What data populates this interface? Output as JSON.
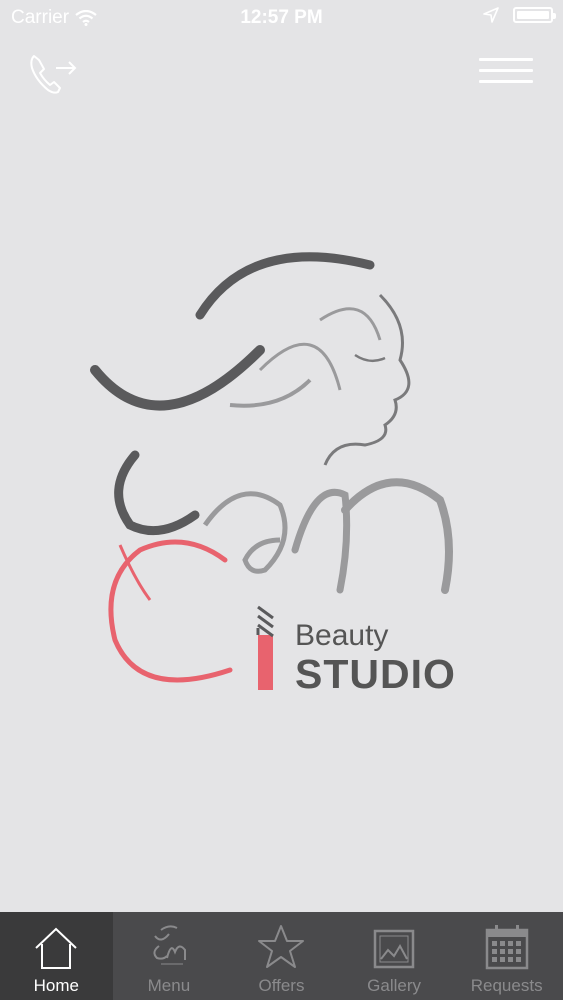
{
  "status_bar": {
    "carrier": "Carrier",
    "time": "12:57 PM"
  },
  "header": {
    "call_icon": "phone-forward-icon",
    "menu_icon": "hamburger-menu-icon"
  },
  "logo": {
    "beauty": "Beauty",
    "studio": "STUDIO",
    "colors": {
      "dark": "#5a5a5c",
      "gray": "#9a9a9c",
      "pink": "#e8636e"
    }
  },
  "tabs": [
    {
      "label": "Home",
      "icon": "home-icon",
      "active": true
    },
    {
      "label": "Menu",
      "icon": "logo-icon",
      "active": false
    },
    {
      "label": "Offers",
      "icon": "star-icon",
      "active": false
    },
    {
      "label": "Gallery",
      "icon": "gallery-icon",
      "active": false
    },
    {
      "label": "Requests",
      "icon": "calendar-icon",
      "active": false
    }
  ]
}
